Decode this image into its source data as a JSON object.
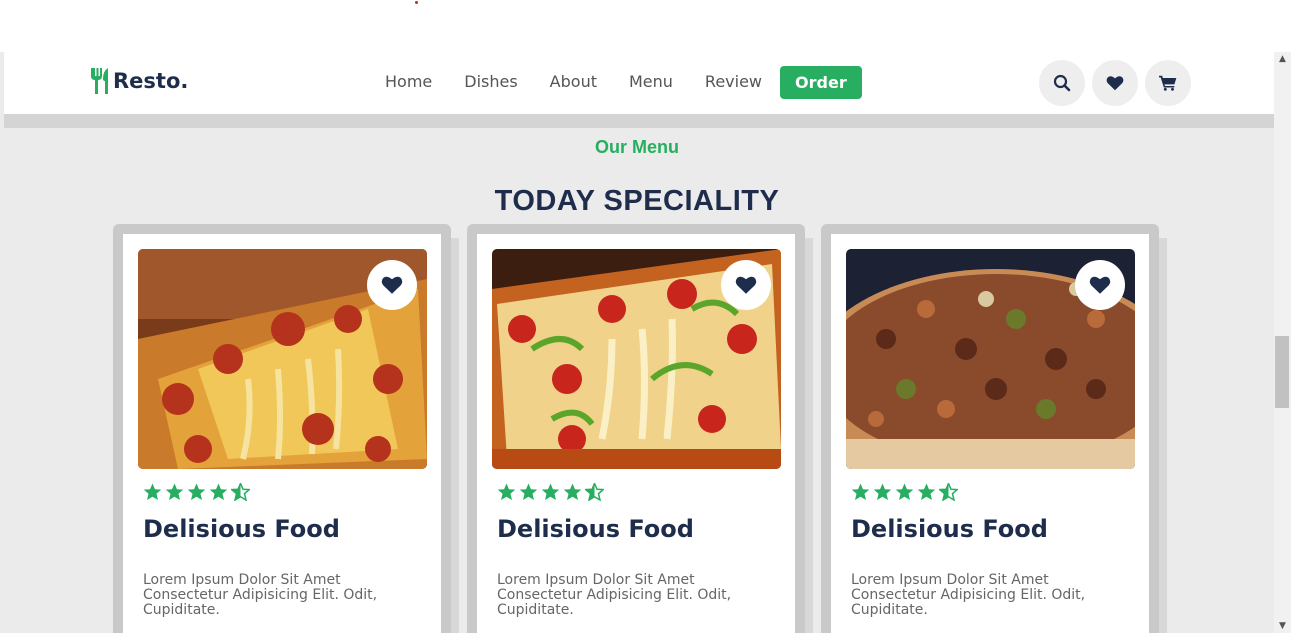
{
  "brand": {
    "name": "Resto."
  },
  "nav": {
    "items": [
      "Home",
      "Dishes",
      "About",
      "Menu",
      "Review"
    ],
    "order_label": "Order"
  },
  "header_icons": [
    "search-icon",
    "heart-icon",
    "cart-icon"
  ],
  "section": {
    "subheading": "Our Menu",
    "heading": "TODAY SPECIALITY"
  },
  "cards": [
    {
      "title": "Delisious Food",
      "description": "Lorem Ipsum Dolor Sit Amet Consectetur Adipisicing Elit. Odit, Cupiditate.",
      "rating": 4.5,
      "image": "pepperoni-pizza-slice"
    },
    {
      "title": "Delisious Food",
      "description": "Lorem Ipsum Dolor Sit Amet Consectetur Adipisicing Elit. Odit, Cupiditate.",
      "rating": 4.5,
      "image": "pepper-pizza-slice"
    },
    {
      "title": "Delisious Food",
      "description": "Lorem Ipsum Dolor Sit Amet Consectetur Adipisicing Elit. Odit, Cupiditate.",
      "rating": 4.5,
      "image": "supreme-pizza"
    }
  ],
  "colors": {
    "accent": "#27ae60",
    "heading": "#1f2d4d",
    "text": "#666666",
    "background": "#ebebeb"
  }
}
